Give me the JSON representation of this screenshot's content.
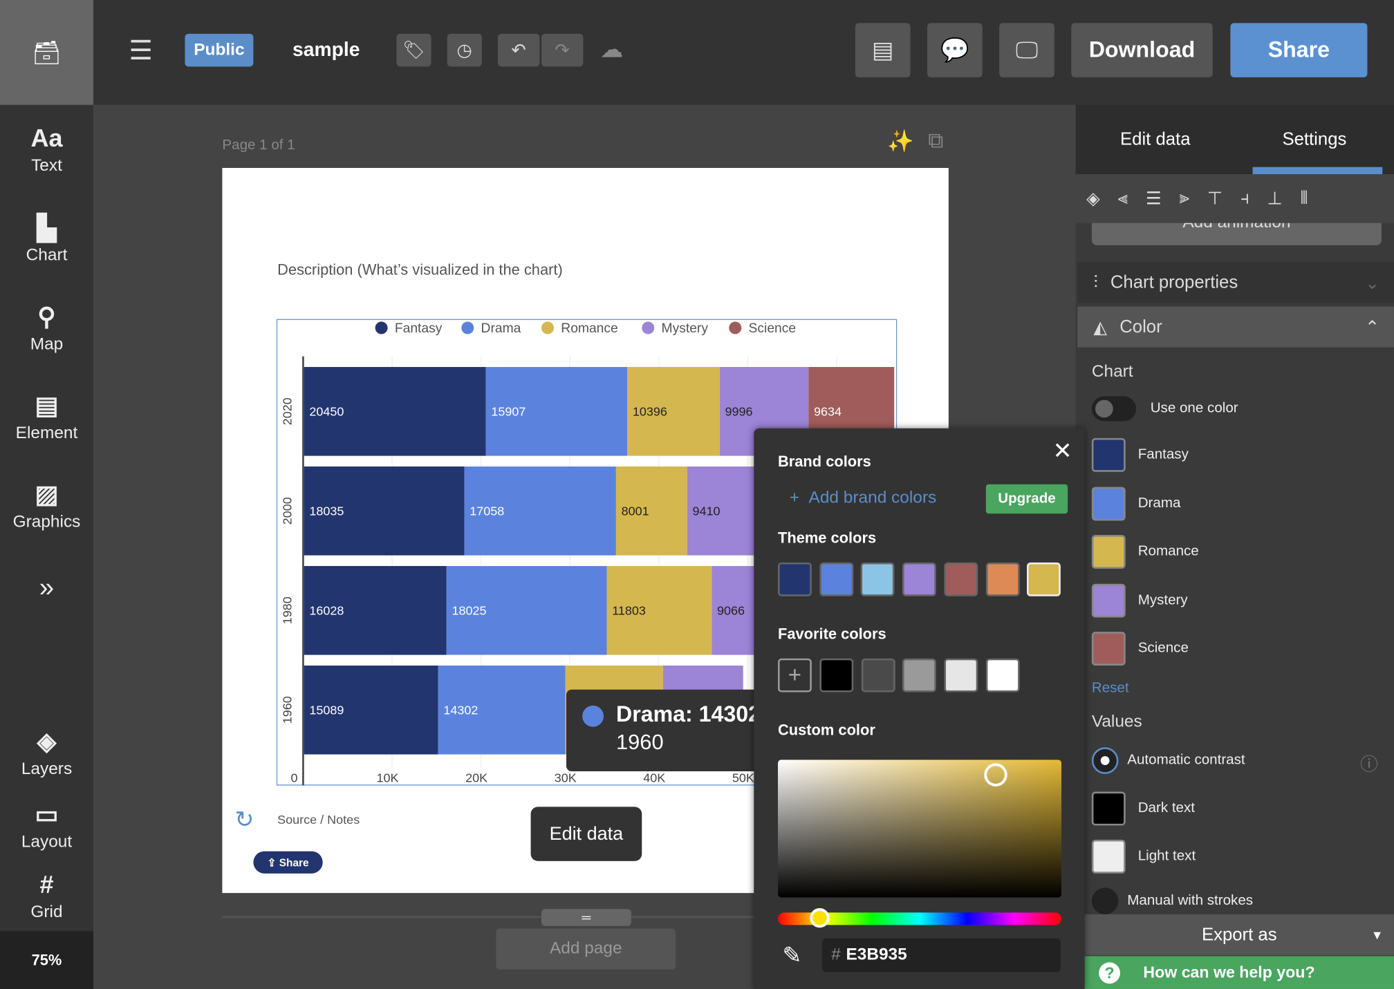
{
  "leftbar": {
    "items": [
      {
        "label": "Text",
        "icon": "Aa"
      },
      {
        "label": "Chart",
        "icon": "chart-icon"
      },
      {
        "label": "Map",
        "icon": "map-pin-icon"
      },
      {
        "label": "Element",
        "icon": "element-icon"
      },
      {
        "label": "Graphics",
        "icon": "image-icon"
      }
    ],
    "more_icon": "double-chevron-icon",
    "bottom": [
      {
        "label": "Layers"
      },
      {
        "label": "Layout"
      },
      {
        "label": "Grid"
      }
    ],
    "zoom": "75%"
  },
  "topbar": {
    "visibility": "Public",
    "title": "sample",
    "download": "Download",
    "share": "Share"
  },
  "canvas": {
    "page_label": "Page 1 of 1",
    "description": "Description (What’s visualized in the chart)",
    "source": "Source / Notes",
    "share_badge": "Share",
    "edit_data": "Edit data",
    "add_page": "Add page"
  },
  "chart_data": {
    "type": "bar",
    "orientation": "horizontal",
    "stacked": true,
    "categories": [
      "2020",
      "2000",
      "1980",
      "1960"
    ],
    "series": [
      {
        "name": "Fantasy",
        "color": "#22356f",
        "values": [
          20450,
          18035,
          16028,
          15089
        ]
      },
      {
        "name": "Drama",
        "color": "#5b83dd",
        "values": [
          15907,
          17058,
          18025,
          14302
        ]
      },
      {
        "name": "Romance",
        "color": "#d5b750",
        "values": [
          10396,
          8001,
          11803,
          11000
        ]
      },
      {
        "name": "Mystery",
        "color": "#9c84d6",
        "values": [
          9996,
          9410,
          9066,
          9000
        ]
      },
      {
        "name": "Science",
        "color": "#a05c5a",
        "values": [
          9634,
          null,
          null,
          null
        ]
      }
    ],
    "xticks": [
      "0",
      "10K",
      "20K",
      "30K",
      "40K",
      "50K"
    ],
    "xlim": [
      0,
      66600
    ],
    "grid": true,
    "legend": "top",
    "tooltip": {
      "series": "Drama",
      "value": "14302",
      "category": "1960",
      "title": "Drama: 14302"
    }
  },
  "right": {
    "tabs": [
      "Edit data",
      "Settings"
    ],
    "add_animation": "Add animation",
    "chart_properties": "Chart properties",
    "color": "Color",
    "chart_label": "Chart",
    "use_one_color": "Use one color",
    "series_colors": [
      {
        "name": "Fantasy",
        "color": "#22356f"
      },
      {
        "name": "Drama",
        "color": "#5b83dd"
      },
      {
        "name": "Romance",
        "color": "#d5b750"
      },
      {
        "name": "Mystery",
        "color": "#9c84d6"
      },
      {
        "name": "Science",
        "color": "#a05c5a"
      }
    ],
    "reset": "Reset",
    "values_label": "Values",
    "automatic_contrast": "Automatic contrast",
    "dark_text": "Dark text",
    "light_text": "Light text",
    "manual_strokes": "Manual with strokes",
    "export": "Export as",
    "help": "How can we help you?"
  },
  "picker": {
    "brand": "Brand colors",
    "add_brand": "Add brand colors",
    "upgrade": "Upgrade",
    "theme": "Theme colors",
    "theme_colors": [
      "#22356f",
      "#5b83dd",
      "#8cc4e6",
      "#9c84d6",
      "#a05c5a",
      "#de8a57",
      "#d5b750"
    ],
    "favorite": "Favorite colors",
    "favorite_colors": [
      "#000000",
      "#4a4a4a",
      "#9a9a9a",
      "#e6e6e6",
      "#ffffff"
    ],
    "custom": "Custom color",
    "hex_prefix": "#",
    "hex": "E3B935"
  }
}
